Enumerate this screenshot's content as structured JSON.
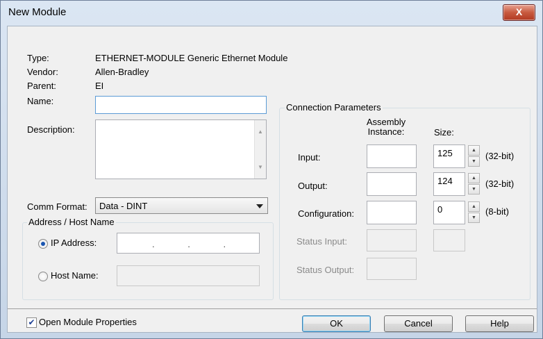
{
  "window": {
    "title": "New Module",
    "close_symbol": "X"
  },
  "info": {
    "type_label": "Type:",
    "type_value": "ETHERNET-MODULE Generic Ethernet Module",
    "vendor_label": "Vendor:",
    "vendor_value": "Allen-Bradley",
    "parent_label": "Parent:",
    "parent_value": "EI",
    "name_label": "Name:",
    "name_value": "",
    "description_label": "Description:",
    "description_value": "",
    "comm_format_label": "Comm Format:",
    "comm_format_value": "Data - DINT"
  },
  "address": {
    "group_title": "Address / Host Name",
    "ip_label": "IP Address:",
    "ip_value": ". . .",
    "ip_selected": true,
    "host_label": "Host Name:",
    "host_value": ""
  },
  "connection": {
    "group_title": "Connection Parameters",
    "col_instance": "Assembly Instance:",
    "col_size": "Size:",
    "rows": [
      {
        "label": "Input:",
        "instance": "",
        "size": "125",
        "unit": "(32-bit)"
      },
      {
        "label": "Output:",
        "instance": "",
        "size": "124",
        "unit": "(32-bit)"
      },
      {
        "label": "Configuration:",
        "instance": "",
        "size": "0",
        "unit": "(8-bit)"
      },
      {
        "label": "Status Input:",
        "instance": "",
        "size": ""
      },
      {
        "label": "Status Output:",
        "instance": ""
      }
    ]
  },
  "footer": {
    "open_props_label": "Open Module Properties",
    "open_props_checked": true,
    "ok_label": "OK",
    "cancel_label": "Cancel",
    "help_label": "Help"
  },
  "icons": {
    "spin_up": "▲",
    "spin_down": "▼",
    "check": "✔"
  }
}
